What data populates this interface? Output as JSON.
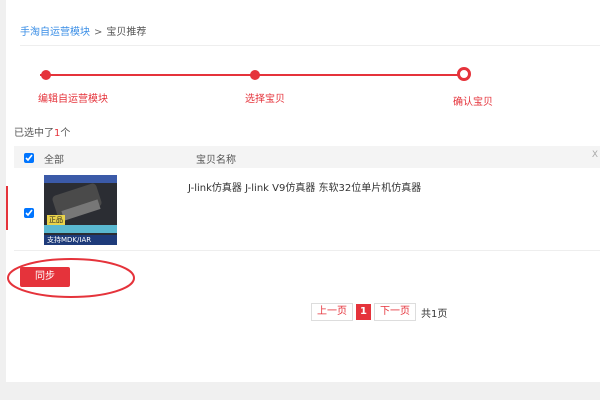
{
  "breadcrumb": {
    "link": "手淘自运营模块",
    "separator": ">",
    "current": "宝贝推荐"
  },
  "steps": [
    {
      "label": "编辑自运营模块"
    },
    {
      "label": "选择宝贝"
    },
    {
      "label": "确认宝贝"
    }
  ],
  "selection": {
    "prefix": "已选中了",
    "count": "1",
    "suffix": "个"
  },
  "table": {
    "header_all": "全部",
    "header_name": "宝贝名称",
    "header_extra": "X",
    "rows": [
      {
        "checked": true,
        "title": "J-link仿真器 J-link V9仿真器 东软32位单片机仿真器",
        "thumb_tag": "正品",
        "thumb_bottom": "支持MDK/IAR"
      }
    ]
  },
  "actions": {
    "sync_label": "同步"
  },
  "pagination": {
    "prev": "上一页",
    "current": "1",
    "next": "下一页",
    "total": "共1页"
  },
  "colors": {
    "accent": "#e5333b",
    "link": "#3a8ee6"
  }
}
